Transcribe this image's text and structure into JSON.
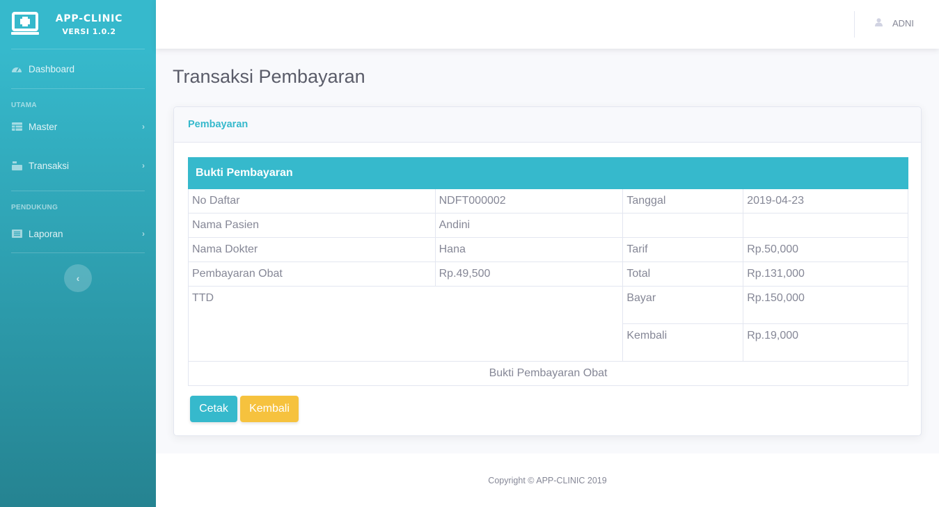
{
  "brand": {
    "title": "APP-CLINIC",
    "version": "VERSI 1.0.2",
    "icon": "clinic-monitor-icon"
  },
  "sidebar": {
    "dashboard": {
      "label": "Dashboard",
      "icon": "tachometer-icon"
    },
    "heading_utama": "UTAMA",
    "master": {
      "label": "Master",
      "icon": "table-icon"
    },
    "transaksi": {
      "label": "Transaksi",
      "icon": "cash-register-icon"
    },
    "heading_pendukung": "PENDUKUNG",
    "laporan": {
      "label": "Laporan",
      "icon": "list-alt-icon"
    },
    "chevron": "›",
    "toggle": "‹"
  },
  "topbar": {
    "user_name": "ADNI",
    "user_icon": "user-icon"
  },
  "page": {
    "title": "Transaksi Pembayaran"
  },
  "card": {
    "header": "Pembayaran",
    "receipt": {
      "title": "Bukti Pembayaran",
      "rows": [
        {
          "l1": "No Daftar",
          "v1": "NDFT000002",
          "l2": "Tanggal",
          "v2": "2019-04-23"
        },
        {
          "l1": "Nama Pasien",
          "v1": "Andini",
          "l2": "",
          "v2": ""
        },
        {
          "l1": "Nama Dokter",
          "v1": "Hana",
          "l2": "Tarif",
          "v2": "Rp.50,000"
        },
        {
          "l1": "Pembayaran Obat",
          "v1": "Rp.49,500",
          "l2": "Total",
          "v2": "Rp.131,000"
        }
      ],
      "ttd_label": "TTD",
      "bayar_label": "Bayar",
      "bayar_value": "Rp.150,000",
      "kembali_label": "Kembali",
      "kembali_value": "Rp.19,000",
      "footer": "Bukti Pembayaran Obat"
    },
    "buttons": {
      "print": "Cetak",
      "back": "Kembali"
    }
  },
  "footer": {
    "copyright": "Copyright © APP-CLINIC 2019"
  },
  "colors": {
    "primary": "#36b9cc",
    "warning": "#f6c23e",
    "text": "#858796",
    "title": "#5a5c69"
  }
}
